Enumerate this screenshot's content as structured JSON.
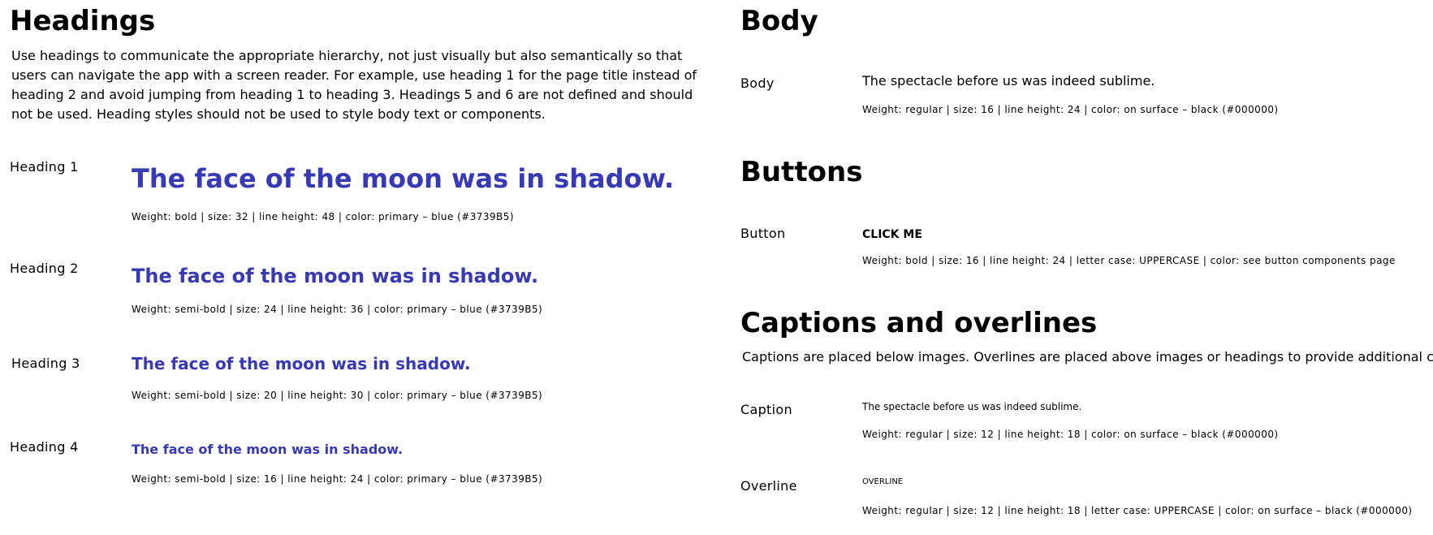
{
  "headings": {
    "title": "Headings",
    "intro": "Use headings to communicate the appropriate hierarchy, not just visually but also semantically so that users can navigate the app with a screen reader. For example, use heading 1 for the page title instead of heading 2 and avoid jumping from heading 1 to heading 3. Headings 5 and 6 are not defined and should not be used. Heading styles should not be used to style body text or components.",
    "items": [
      {
        "label": "Heading 1",
        "sample": "The face of the moon was in shadow.",
        "spec": "Weight: bold | size: 32 | line height: 48 | color: primary – blue (#3739B5)"
      },
      {
        "label": "Heading 2",
        "sample": "The face of the moon was in shadow.",
        "spec": "Weight: semi-bold | size: 24 | line height: 36 | color: primary – blue (#3739B5)"
      },
      {
        "label": "Heading 3",
        "sample": "The face of the moon was in shadow.",
        "spec": "Weight: semi-bold | size: 20 | line height: 30 | color: primary – blue (#3739B5)"
      },
      {
        "label": "Heading 4",
        "sample": "The face of the moon was in shadow.",
        "spec": "Weight: semi-bold | size: 16 | line height: 24 | color: primary – blue (#3739B5)"
      }
    ]
  },
  "body": {
    "title": "Body",
    "label": "Body",
    "sample": "The spectacle before us was indeed sublime.",
    "spec": "Weight: regular | size: 16 | line height: 24 | color: on surface – black (#000000)"
  },
  "buttons": {
    "title": "Buttons",
    "label": "Button",
    "sample": "CLICK ME",
    "spec": "Weight: bold | size: 16 | line height: 24 | letter case: UPPERCASE | color: see button components page"
  },
  "captions": {
    "title": "Captions and overlines",
    "intro": "Captions are placed below images. Overlines are placed above images or headings to provide additional context.",
    "caption": {
      "label": "Caption",
      "sample": "The spectacle before us was indeed sublime.",
      "spec": "Weight: regular | size: 12 | line height: 18 | color: on surface – black (#000000)"
    },
    "overline": {
      "label": "Overline",
      "sample": "OVERLINE",
      "spec": "Weight: regular | size: 12 | line height: 18  | letter case: UPPERCASE  | color: on surface – black (#000000)"
    }
  },
  "colors": {
    "primary": "#3739B5",
    "on_surface": "#000000"
  }
}
